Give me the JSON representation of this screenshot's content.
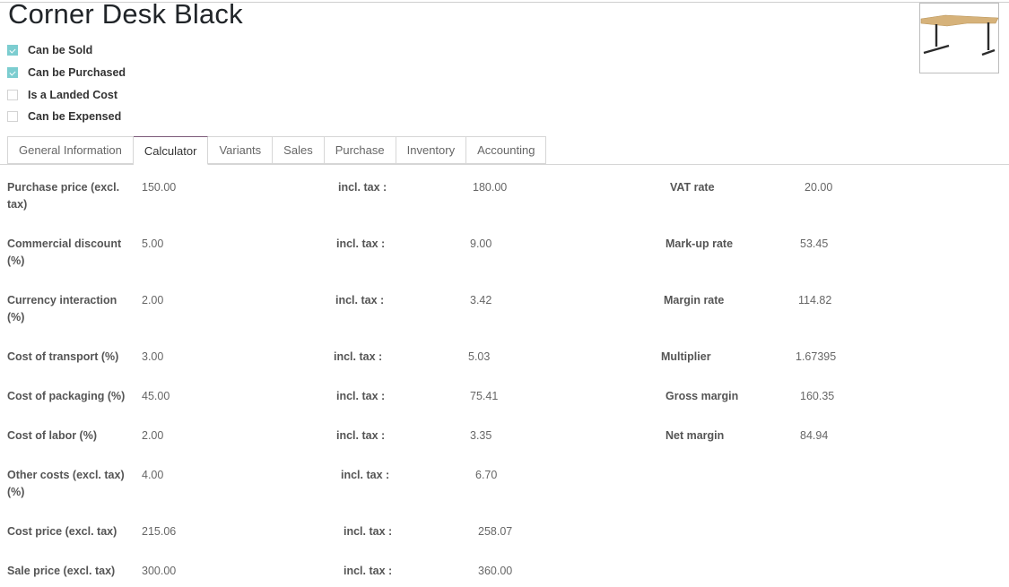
{
  "product": {
    "name": "Corner Desk Black",
    "image": "corner-desk-image"
  },
  "checkboxes": [
    {
      "label": "Can be Sold",
      "checked": true
    },
    {
      "label": "Can be Purchased",
      "checked": true
    },
    {
      "label": "Is a Landed Cost",
      "checked": false
    },
    {
      "label": "Can be Expensed",
      "checked": false
    }
  ],
  "colors": {
    "checkbox_checked": "#7ccdd0",
    "active_tab_accent": "#7c5a78"
  },
  "tabs": [
    {
      "label": "General Information",
      "active": false
    },
    {
      "label": "Calculator",
      "active": true
    },
    {
      "label": "Variants",
      "active": false
    },
    {
      "label": "Sales",
      "active": false
    },
    {
      "label": "Purchase",
      "active": false
    },
    {
      "label": "Inventory",
      "active": false
    },
    {
      "label": "Accounting",
      "active": false
    }
  ],
  "calculator": {
    "rows": [
      {
        "label": "Purchase price (excl. tax)",
        "value": "150.00",
        "incl_label": "incl. tax :",
        "incl_value": "180.00"
      },
      {
        "label": "Commercial discount (%)",
        "value": "5.00",
        "incl_label": "incl. tax :",
        "incl_value": "9.00"
      },
      {
        "label": "Currency interaction (%)",
        "value": "2.00",
        "incl_label": "incl. tax :",
        "incl_value": "3.42"
      },
      {
        "label": "Cost of transport (%)",
        "value": "3.00",
        "incl_label": "incl. tax :",
        "incl_value": "5.03"
      },
      {
        "label": "Cost of packaging (%)",
        "value": "45.00",
        "incl_label": "incl. tax :",
        "incl_value": "75.41"
      },
      {
        "label": "Cost of labor (%)",
        "value": "2.00",
        "incl_label": "incl. tax :",
        "incl_value": "3.35"
      },
      {
        "label": "Other costs (excl. tax) (%)",
        "value": "4.00",
        "incl_label": "incl. tax :",
        "incl_value": "6.70"
      },
      {
        "label": "Cost price (excl. tax)",
        "value": "215.06",
        "incl_label": "incl. tax :",
        "incl_value": "258.07"
      },
      {
        "label": "Sale price (excl. tax)",
        "value": "300.00",
        "incl_label": "incl. tax :",
        "incl_value": "360.00"
      }
    ],
    "rates": [
      {
        "label": "VAT rate",
        "value": "20.00"
      },
      {
        "label": "Mark-up rate",
        "value": "53.45"
      },
      {
        "label": "Margin rate",
        "value": "114.82"
      },
      {
        "label": "Multiplier",
        "value": "1.67395"
      },
      {
        "label": "Gross margin",
        "value": "160.35"
      },
      {
        "label": "Net margin",
        "value": "84.94"
      }
    ]
  }
}
